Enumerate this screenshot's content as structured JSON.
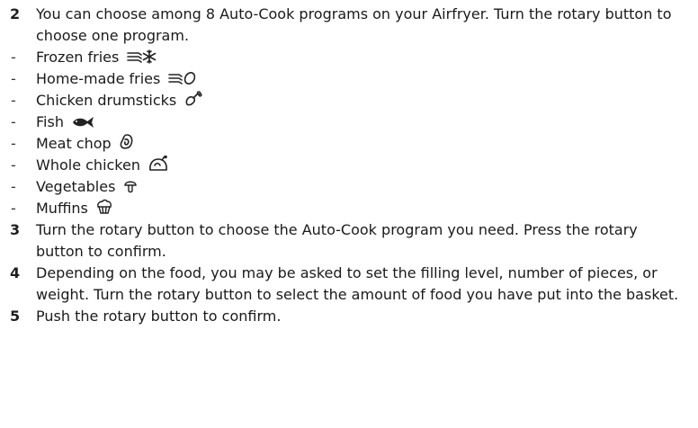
{
  "steps": [
    {
      "num": "2",
      "text": "You can choose among 8 Auto-Cook programs on your Airfryer. Turn the rotary button to choose one program."
    },
    {
      "num": "3",
      "text": "Turn the rotary button to choose the Auto-Cook program you need. Press the rotary button to confirm."
    },
    {
      "num": "4",
      "text": "Depending on the food, you may be asked to set the filling level, number of pieces, or weight. Turn the rotary button to select the amount of food you have put into the basket."
    },
    {
      "num": "5",
      "text": "Push the rotary button to confirm."
    }
  ],
  "bullet_dash": "-",
  "programs": [
    {
      "label": "Frozen fries",
      "icon": "frozen-fries-icon"
    },
    {
      "label": "Home-made fries",
      "icon": "homemade-fries-icon"
    },
    {
      "label": "Chicken drumsticks",
      "icon": "drumstick-icon"
    },
    {
      "label": "Fish",
      "icon": "fish-icon"
    },
    {
      "label": "Meat chop",
      "icon": "meat-chop-icon"
    },
    {
      "label": "Whole chicken",
      "icon": "whole-chicken-icon"
    },
    {
      "label": "Vegetables",
      "icon": "mushroom-icon"
    },
    {
      "label": "Muffins",
      "icon": "muffin-icon"
    }
  ]
}
